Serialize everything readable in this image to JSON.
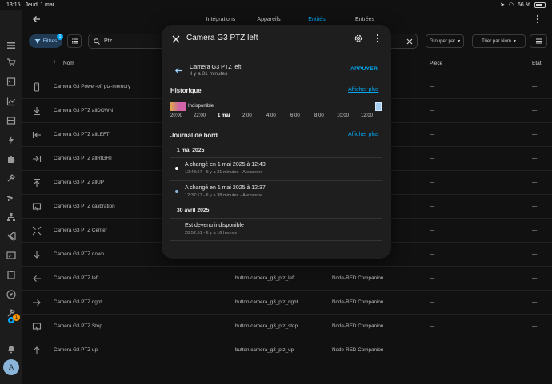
{
  "status_bar": {
    "time": "13:15",
    "date": "Jeudi 1 mai",
    "battery": "66 %"
  },
  "tabs": [
    {
      "label": "Intégrations"
    },
    {
      "label": "Appareils"
    },
    {
      "label": "Entités"
    },
    {
      "label": "Entrées"
    }
  ],
  "toolbar": {
    "filters_label": "Filtres",
    "filters_count": "1",
    "search_value": "Ptz",
    "group_label": "Grouper par",
    "sort_label": "Trier par Nom"
  },
  "table": {
    "col_name": "Nom",
    "col_area": "Pièce",
    "col_status": "État",
    "rows": [
      {
        "name": "Camera G3 Power-off ptz-memory",
        "entity": "",
        "integration": "",
        "area": "—",
        "status": "—"
      },
      {
        "name": "Camera G3 PTZ allDOWN",
        "entity": "",
        "integration": "",
        "area": "—",
        "status": "—"
      },
      {
        "name": "Camera G3 PTZ allLEFT",
        "entity": "",
        "integration": "",
        "area": "—",
        "status": "—"
      },
      {
        "name": "Camera G3 PTZ allRIGHT",
        "entity": "",
        "integration": "",
        "area": "—",
        "status": "—"
      },
      {
        "name": "Camera G3 PTZ allUP",
        "entity": "",
        "integration": "",
        "area": "—",
        "status": "—"
      },
      {
        "name": "Camera G3 PTZ calibration",
        "entity": "",
        "integration": "",
        "area": "—",
        "status": "—"
      },
      {
        "name": "Camera G3 PTZ Center",
        "entity": "",
        "integration": "",
        "area": "—",
        "status": "—"
      },
      {
        "name": "Camera G3 PTZ down",
        "entity": "",
        "integration": "",
        "area": "—",
        "status": "—"
      },
      {
        "name": "Camera G3 PTZ left",
        "entity": "button.camera_g3_ptz_left",
        "integration": "Node-RED Companion",
        "area": "—",
        "status": "—"
      },
      {
        "name": "Camera G3 PTZ right",
        "entity": "button.camera_g3_ptz_right",
        "integration": "Node-RED Companion",
        "area": "—",
        "status": "—"
      },
      {
        "name": "Camera G3 PTZ Stop",
        "entity": "button.camera_g3_ptz_stop",
        "integration": "Node-RED Companion",
        "area": "—",
        "status": "—"
      },
      {
        "name": "Camera G3 PTZ up",
        "entity": "button.camera_g3_ptz_up",
        "integration": "Node-RED Companion",
        "area": "—",
        "status": "—"
      }
    ]
  },
  "sidebar": {
    "notifications_count": "1",
    "avatar_letter": "A"
  },
  "dialog": {
    "title": "Camera G3 PTZ left",
    "entity_name": "Camera G3 PTZ left",
    "entity_time": "Il y a 31 minutes",
    "press_label": "APPUYER",
    "history_title": "Historique",
    "show_more": "Afficher plus",
    "history_state": "Indisponible",
    "history_ticks": [
      "20:00",
      "22:00",
      "1 mai",
      "2:00",
      "4:00",
      "6:00",
      "8:00",
      "10:00",
      "12:00"
    ],
    "logbook_title": "Journal de bord",
    "logbook": [
      {
        "date": "1 mai 2025"
      },
      {
        "text": "A changé en 1 mai 2025 à 12:43",
        "sub": "12:43:57 - Il y a 31 minutes - Alexandre"
      },
      {
        "text": "A changé en 1 mai 2025 à 12:37",
        "sub": "12:37:17 - Il y a 38 minutes - Alexandre"
      },
      {
        "date": "30 avril 2025"
      },
      {
        "text": "Est devenu indisponible",
        "sub": "20:52:51 - Il y a 16 heures"
      }
    ]
  }
}
